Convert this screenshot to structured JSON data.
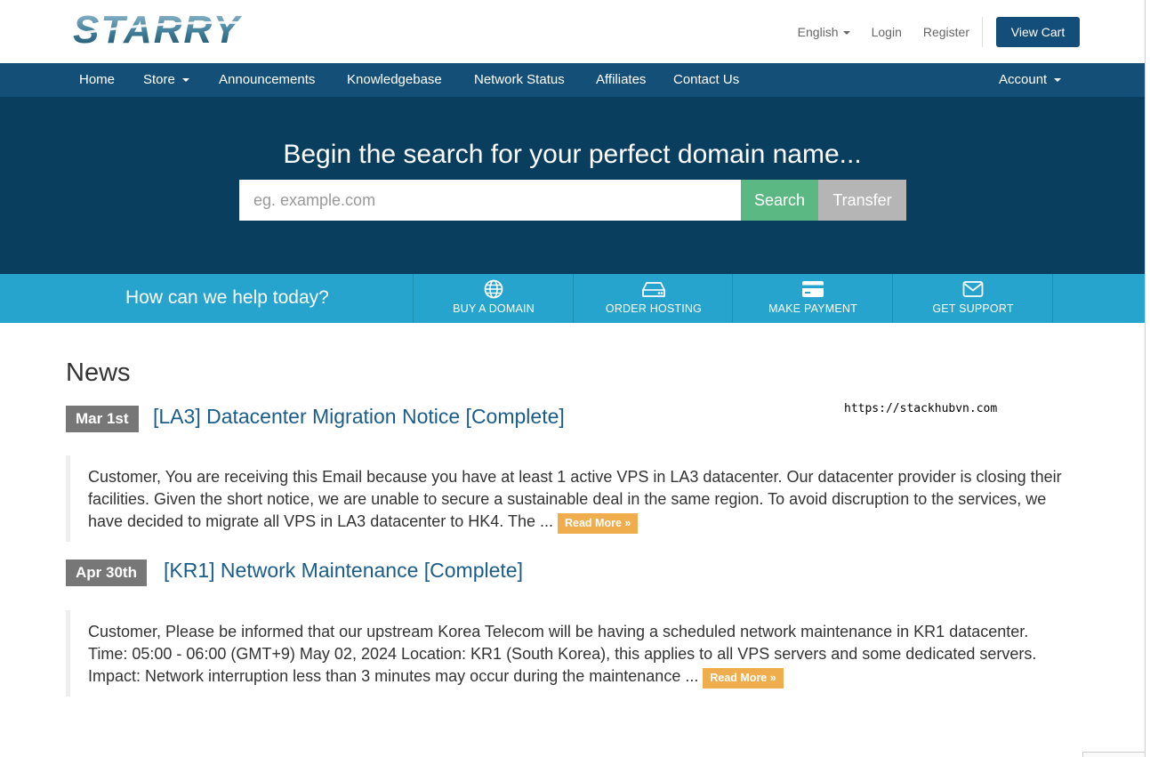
{
  "brand": {
    "logo_text": "STARRY"
  },
  "header": {
    "language": "English",
    "login": "Login",
    "register": "Register",
    "view_cart": "View Cart"
  },
  "nav": {
    "home": "Home",
    "store": "Store",
    "announcements": "Announcements",
    "knowledgebase": "Knowledgebase",
    "network_status": "Network Status",
    "affiliates": "Affiliates",
    "contact_us": "Contact Us",
    "account": "Account"
  },
  "hero": {
    "title": "Begin the search for your perfect domain name...",
    "search_placeholder": "eg. example.com",
    "search_button": "Search",
    "transfer_button": "Transfer"
  },
  "help": {
    "prompt": "How can we help today?",
    "tiles": [
      {
        "label": "BUY A DOMAIN",
        "icon": "globe-icon"
      },
      {
        "label": "ORDER HOSTING",
        "icon": "server-icon"
      },
      {
        "label": "MAKE PAYMENT",
        "icon": "credit-card-icon"
      },
      {
        "label": "GET SUPPORT",
        "icon": "envelope-icon"
      }
    ]
  },
  "news": {
    "heading": "News",
    "watermark": "https://stackhubvn.com",
    "items": [
      {
        "date": "Mar 1st",
        "title": "[LA3] Datacenter Migration Notice [Complete]",
        "excerpt": "Customer, You are receiving this Email because you have at least 1 active VPS in LA3 datacenter. Our datacenter provider is closing their facilities. Given the short notice, we are unable to secure a sustainable deal in the same region. To avoid discruption to the services, we have decided to migrate all VPS in LA3 datacenter to HK4. The ...",
        "read_more": "Read More »"
      },
      {
        "date": "Apr 30th",
        "title": "[KR1] Network Maintenance [Complete]",
        "excerpt": "Customer,   Please be informed that our upstream Korea Telecom will be having a scheduled network maintenance in KR1 datacenter.   Time: 05:00 - 06:00 (GMT+9) May 02, 2024 Location: KR1 (South Korea), this applies to all VPS servers and some dedicated servers. Impact: Network interruption less than 3 minutes may occur during the maintenance ...",
        "read_more": "Read More »"
      }
    ]
  },
  "colors": {
    "nav_bg": "#134f77",
    "hero_bg": "#0a3e5f",
    "help_bg": "#26a4cd",
    "search_green": "#5cb883",
    "read_more_orange": "#f0ad4e",
    "link_blue": "#1a5d8a"
  }
}
